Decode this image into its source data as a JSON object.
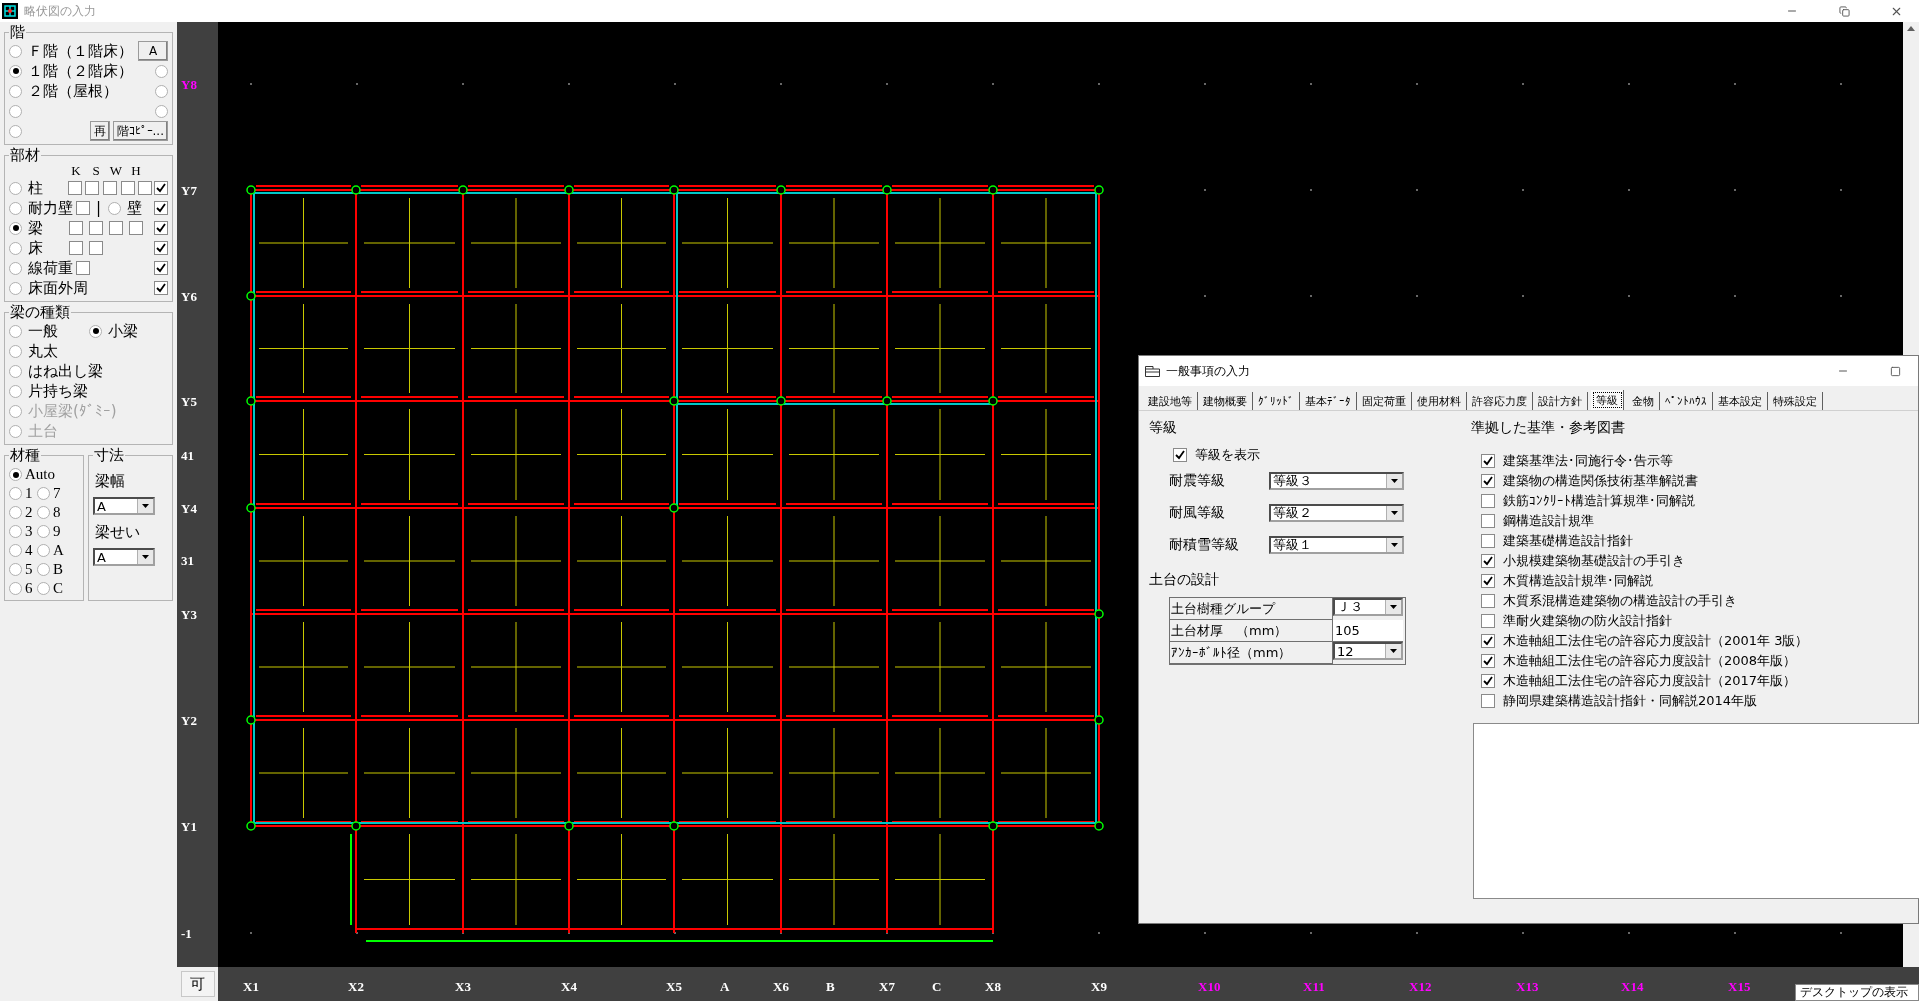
{
  "window": {
    "title": "略伏図の入力"
  },
  "floor_group": {
    "title": "階",
    "left_radios": [
      {
        "label": "Ｆ階（１階床）",
        "selected": false
      },
      {
        "label": "１階（２階床）",
        "selected": true
      },
      {
        "label": "２階（屋根）",
        "selected": false
      },
      {
        "selected": false
      },
      {
        "selected": false
      }
    ],
    "right_radios": [
      {
        "selected": false
      },
      {
        "selected": false
      },
      {
        "selected": false
      }
    ],
    "buttons": [
      "A",
      "再",
      "階ｺﾋﾟｰ..."
    ]
  },
  "members": {
    "title": "部材",
    "columns": [
      "K",
      "S",
      "W",
      "H"
    ],
    "rows": [
      {
        "label": "柱",
        "selected": false,
        "cells": [
          {
            "kind": "check",
            "checked": false
          },
          {
            "kind": "check",
            "checked": false
          },
          {
            "kind": "check",
            "checked": false
          },
          {
            "kind": "check",
            "checked": false
          },
          {
            "kind": "check",
            "checked": false
          }
        ],
        "display_checked": true
      },
      {
        "label": "耐力壁",
        "selected": false,
        "cells": [
          {
            "kind": "check",
            "checked": false
          },
          {
            "kind": "text",
            "text": "|"
          },
          {
            "kind": "radio",
            "selected": false
          },
          {
            "kind": "text",
            "text": "壁"
          }
        ],
        "display_checked": true
      },
      {
        "label": "梁",
        "selected": true,
        "cells": [
          {
            "kind": "check",
            "checked": false
          },
          {
            "kind": "check",
            "checked": false
          },
          {
            "kind": "check",
            "checked": false
          },
          {
            "kind": "check",
            "checked": false
          }
        ],
        "display_checked": true
      },
      {
        "label": "床",
        "selected": false,
        "cells": [
          {
            "kind": "check",
            "checked": false
          },
          {
            "kind": "check",
            "checked": false
          }
        ],
        "display_checked": true
      },
      {
        "label": "線荷重",
        "selected": false,
        "cells": [
          {
            "kind": "check",
            "checked": false
          }
        ],
        "display_checked": true
      },
      {
        "label": "床面外周",
        "selected": false,
        "cells": [],
        "display_checked": true
      }
    ]
  },
  "beam_types": {
    "title": "梁の種類",
    "items": [
      {
        "label": "一般",
        "selected": false,
        "disabled": false
      },
      {
        "label": "小梁",
        "selected": true,
        "disabled": false
      },
      {
        "label": "丸太",
        "selected": false,
        "disabled": false
      },
      {
        "label": "はね出し梁",
        "selected": false,
        "disabled": false
      },
      {
        "label": "片持ち梁",
        "selected": false,
        "disabled": false
      },
      {
        "label": "小屋梁(ﾀﾞﾐｰ)",
        "selected": false,
        "disabled": true
      },
      {
        "label": "土台",
        "selected": false,
        "disabled": true
      }
    ]
  },
  "material": {
    "title": "材種",
    "items": [
      {
        "label": "Auto",
        "selected": true
      },
      {
        "label": "1",
        "selected": false
      },
      {
        "label": "7",
        "selected": false
      },
      {
        "label": "2",
        "selected": false
      },
      {
        "label": "8",
        "selected": false
      },
      {
        "label": "3",
        "selected": false
      },
      {
        "label": "9",
        "selected": false
      },
      {
        "label": "4",
        "selected": false
      },
      {
        "label": "A",
        "selected": false
      },
      {
        "label": "5",
        "selected": false
      },
      {
        "label": "B",
        "selected": false
      },
      {
        "label": "6",
        "selected": false
      },
      {
        "label": "C",
        "selected": false
      }
    ]
  },
  "dimensions": {
    "title": "寸法",
    "fields": [
      {
        "label": "梁幅",
        "value": "A"
      },
      {
        "label": "梁せい",
        "value": "A"
      }
    ]
  },
  "corner_button": "可",
  "y_axis": [
    {
      "label": "Y8",
      "color": "#ff00ff"
    },
    {
      "label": "Y7",
      "color": "#ffffff"
    },
    {
      "label": "Y6",
      "color": "#ffffff"
    },
    {
      "label": "Y5",
      "color": "#ffffff"
    },
    {
      "label": "41",
      "color": "#ffffff"
    },
    {
      "label": "Y4",
      "color": "#ffffff"
    },
    {
      "label": "31",
      "color": "#ffffff"
    },
    {
      "label": "Y3",
      "color": "#ffffff"
    },
    {
      "label": "Y2",
      "color": "#ffffff"
    },
    {
      "label": "Y1",
      "color": "#ffffff"
    },
    {
      "label": "-1",
      "color": "#ffffff"
    }
  ],
  "x_axis": [
    {
      "label": "X1",
      "color": "#ffffff"
    },
    {
      "label": "X2",
      "color": "#ffffff"
    },
    {
      "label": "X3",
      "color": "#ffffff"
    },
    {
      "label": "X4",
      "color": "#ffffff"
    },
    {
      "label": "X5",
      "color": "#ffffff"
    },
    {
      "label": "A",
      "color": "#ffffff"
    },
    {
      "label": "X6",
      "color": "#ffffff"
    },
    {
      "label": "B",
      "color": "#ffffff"
    },
    {
      "label": "X7",
      "color": "#ffffff"
    },
    {
      "label": "C",
      "color": "#ffffff"
    },
    {
      "label": "X8",
      "color": "#ffffff"
    },
    {
      "label": "X9",
      "color": "#ffffff"
    },
    {
      "label": "X10",
      "color": "#ff00ff"
    },
    {
      "label": "X11",
      "color": "#ff00ff"
    },
    {
      "label": "X12",
      "color": "#ff00ff"
    },
    {
      "label": "X13",
      "color": "#ff00ff"
    },
    {
      "label": "X14",
      "color": "#ff00ff"
    },
    {
      "label": "X15",
      "color": "#ff00ff"
    }
  ],
  "dialog": {
    "title": "一般事項の入力",
    "tabs": [
      {
        "label": "建設地等",
        "selected": false
      },
      {
        "label": "建物概要",
        "selected": false
      },
      {
        "label": "ｸﾞﾘｯﾄﾞ",
        "selected": false
      },
      {
        "label": "基本ﾃﾞｰﾀ",
        "selected": false
      },
      {
        "label": "固定荷重",
        "selected": false
      },
      {
        "label": "使用材料",
        "selected": false
      },
      {
        "label": "許容応力度",
        "selected": false
      },
      {
        "label": "設計方針",
        "selected": false
      },
      {
        "label": "等級",
        "selected": true
      },
      {
        "label": "金物",
        "selected": false
      },
      {
        "label": "ﾍﾟﾝﾄﾊｳｽ",
        "selected": false
      },
      {
        "label": "基本設定",
        "selected": false
      },
      {
        "label": "特殊設定",
        "selected": false
      }
    ],
    "grade": {
      "title": "等級",
      "show": {
        "label": "等級を表示",
        "checked": true
      },
      "selects": [
        {
          "label": "耐震等級",
          "value": "等級３"
        },
        {
          "label": "耐風等級",
          "value": "等級２"
        },
        {
          "label": "耐積雪等級",
          "value": "等級１"
        }
      ]
    },
    "sill": {
      "title": "土台の設計",
      "rows": [
        {
          "label": "土台樹種グループ",
          "value": "Ｊ３",
          "kind": "select"
        },
        {
          "label": "土台材厚　（mm）",
          "value": "105",
          "kind": "input"
        },
        {
          "label": "ｱﾝｶｰﾎﾞﾙﾄ径（mm）",
          "value": "12",
          "kind": "select"
        }
      ]
    },
    "references": {
      "title": "準拠した基準・参考図書",
      "items": [
        {
          "label": "建築基準法･同施行令･告示等",
          "checked": true
        },
        {
          "label": "建築物の構造関係技術基準解説書",
          "checked": true
        },
        {
          "label": "鉄筋ｺﾝｸﾘｰﾄ構造計算規準･同解説",
          "checked": false
        },
        {
          "label": "鋼構造設計規準",
          "checked": false
        },
        {
          "label": "建築基礎構造設計指針",
          "checked": false
        },
        {
          "label": "小規模建築物基礎設計の手引き",
          "checked": true
        },
        {
          "label": "木質構造設計規準･同解説",
          "checked": true
        },
        {
          "label": "木質系混構造建築物の構造設計の手引き",
          "checked": false
        },
        {
          "label": "準耐火建築物の防火設計指針",
          "checked": false
        },
        {
          "label": "木造軸組工法住宅の許容応力度設計（2001年 3版）",
          "checked": true
        },
        {
          "label": "木造軸組工法住宅の許容応力度設計（2008年版）",
          "checked": true
        },
        {
          "label": "木造軸組工法住宅の許容応力度設計（2017年版）",
          "checked": true
        },
        {
          "label": "静岡県建築構造設計指針・同解説2014年版",
          "checked": false
        }
      ]
    }
  },
  "tooltip": "デスクトップの表示"
}
